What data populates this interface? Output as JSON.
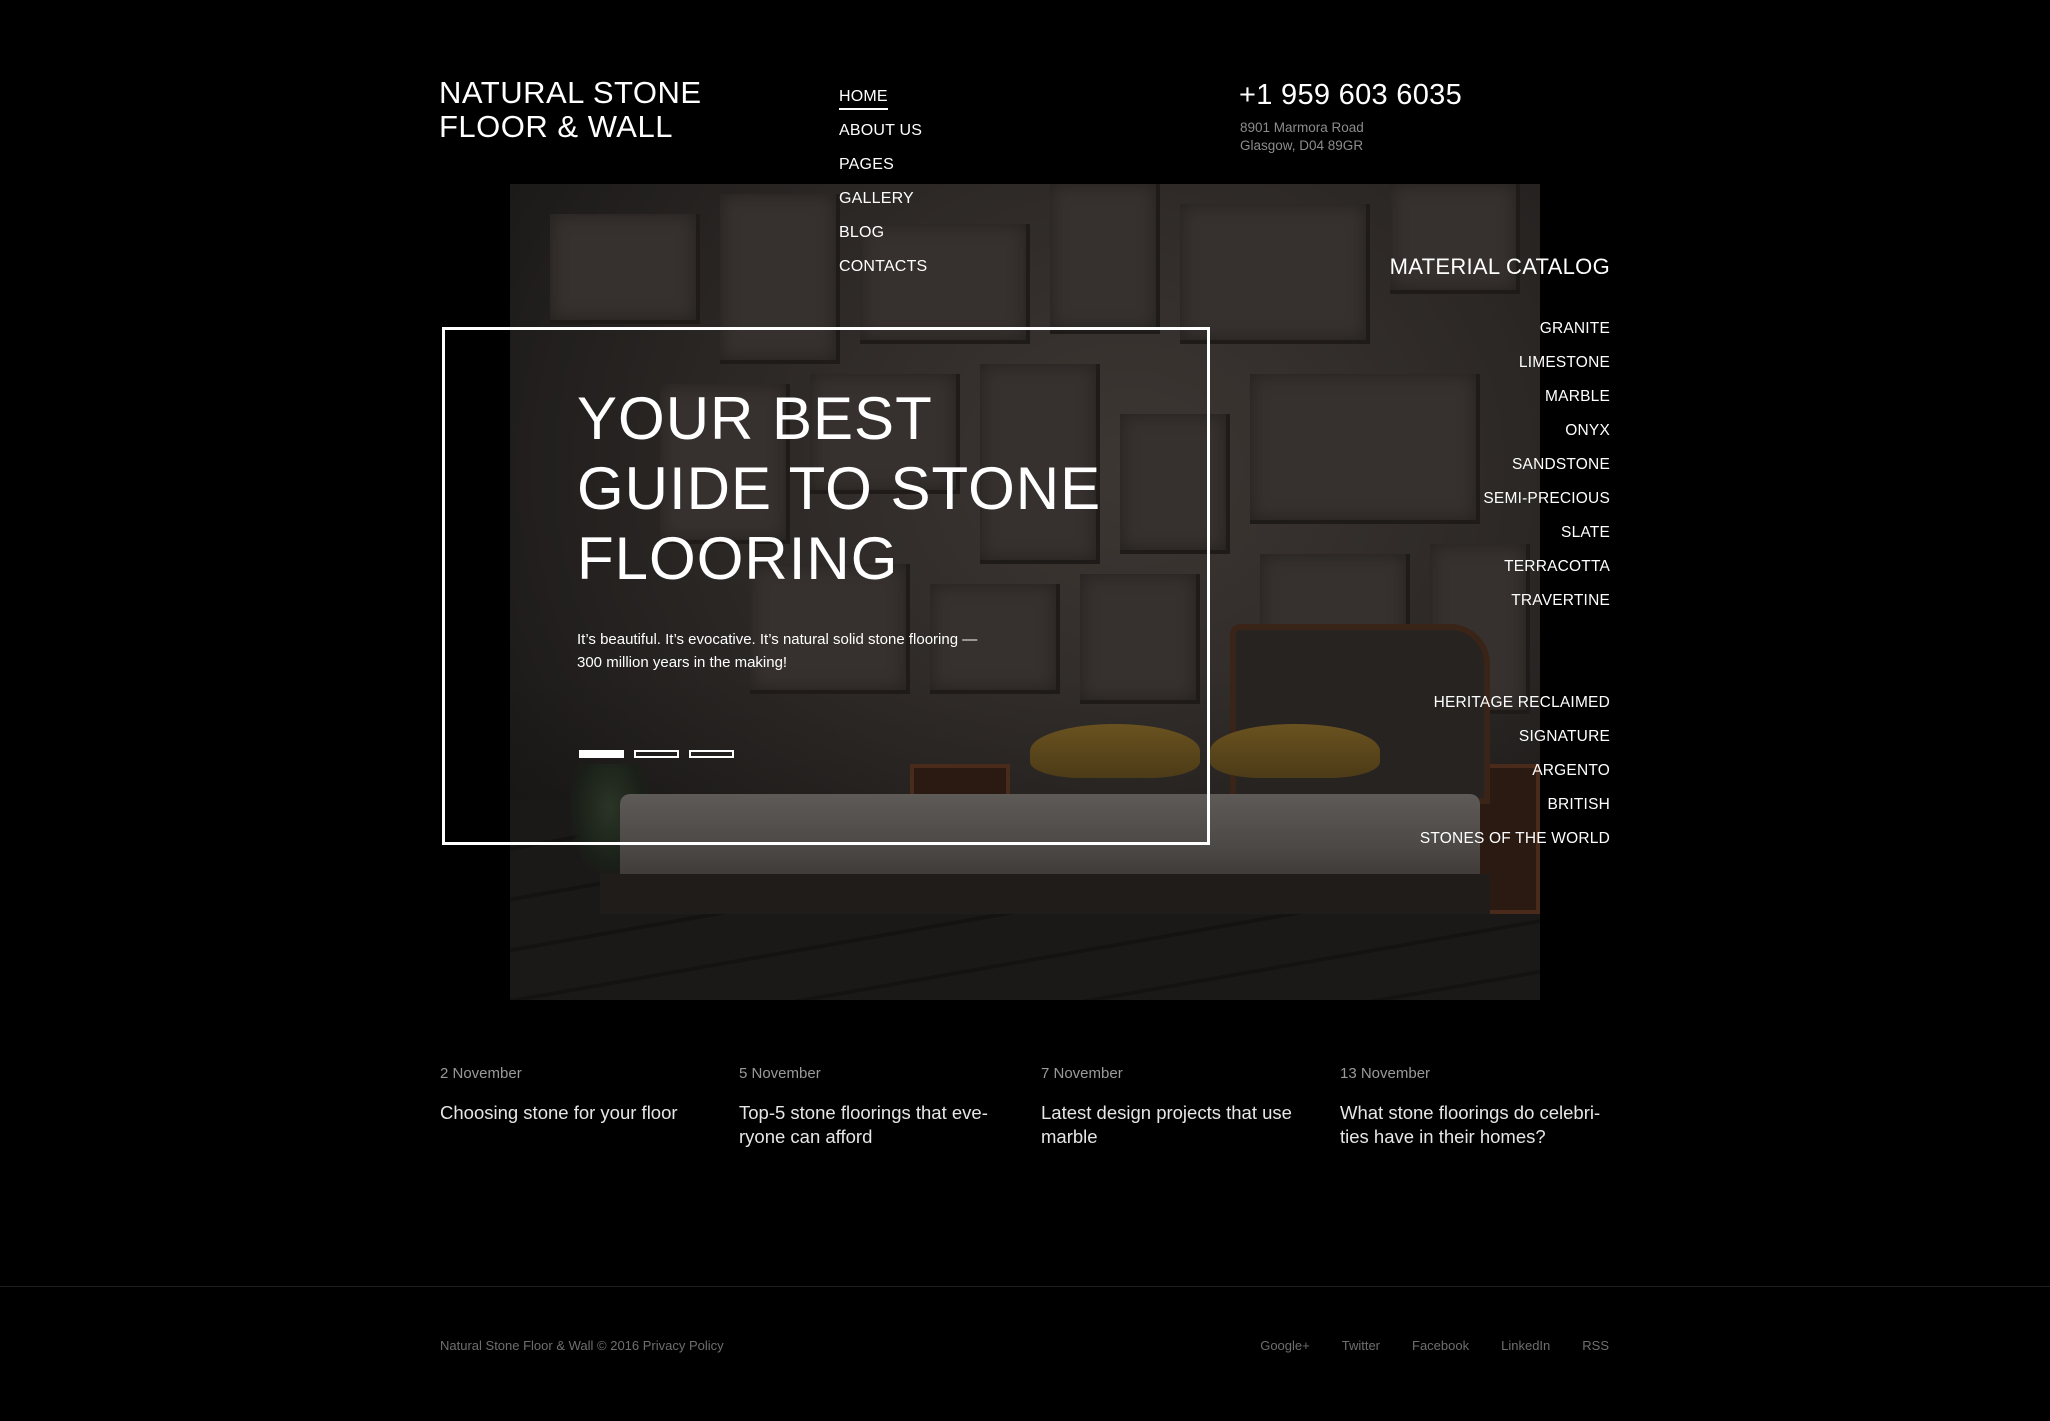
{
  "header": {
    "logo_line1": "NATURAL STONE",
    "logo_line2": "FLOOR & WALL",
    "nav": [
      {
        "label": "HOME",
        "active": true
      },
      {
        "label": "ABOUT US"
      },
      {
        "label": "PAGES"
      },
      {
        "label": "GALLERY"
      },
      {
        "label": "BLOG"
      },
      {
        "label": "CONTACTS"
      }
    ],
    "phone": "+1 959 603 6035",
    "address_line1": "8901 Marmora Road",
    "address_line2": "Glasgow, D04 89GR"
  },
  "catalog": {
    "title": "MATERIAL CATALOG",
    "group1": [
      "GRANITE",
      "LIMESTONE",
      "MARBLE",
      "ONYX",
      "SANDSTONE",
      "SEMI-PRECIOUS",
      "SLATE",
      "TERRACOTTA",
      "TRAVERTINE"
    ],
    "group2": [
      "HERITAGE RECLAIMED",
      "SIGNATURE",
      "ARGENTO",
      "BRITISH",
      "STONES OF THE WORLD"
    ]
  },
  "hero": {
    "title_line1": "YOUR BEST",
    "title_line2": "GUIDE TO STONE",
    "title_line3": "FLOORING",
    "text": "It’s beautiful. It’s evocative. It’s natural solid stone flooring — 300 million years in the making!",
    "slides_total": 3,
    "active_slide": 1
  },
  "news": [
    {
      "date": "2 November",
      "title": "Choosing stone for your floor"
    },
    {
      "date": "5 November",
      "title": "Top-5 stone floorings that eve-ryone can afford"
    },
    {
      "date": "7 November",
      "title": "Latest design projects that use marble"
    },
    {
      "date": "13 November",
      "title": "What stone floorings do celebri-ties have in their homes?"
    }
  ],
  "footer": {
    "copyright": "Natural Stone Floor & Wall © 2016",
    "privacy": "Privacy Policy",
    "socials": [
      "Google+",
      "Twitter",
      "Facebook",
      "LinkedIn",
      "RSS"
    ]
  },
  "colors": {
    "background": "#000000",
    "text": "#ffffff",
    "muted": "#8c8c8c",
    "footer_text": "#6e6e6e"
  }
}
